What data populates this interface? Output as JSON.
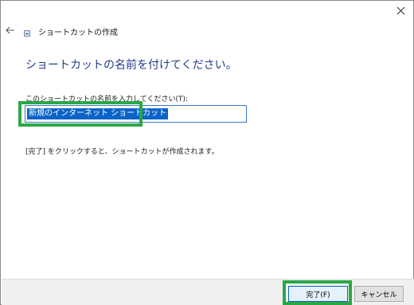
{
  "wizard": {
    "title": "ショートカットの作成",
    "heading": "ショートカットの名前を付けてください。",
    "name_label": "このショートカットの名前を入力してください(T):",
    "name_value": "新規のインターネット ショートカット",
    "finish_instruction": "[完了] をクリックすると、ショートカットが作成されます。"
  },
  "buttons": {
    "finish_label": "完了(F)",
    "cancel_label": "キャンセル"
  },
  "icons": {
    "close": "close-icon",
    "back": "back-arrow-icon",
    "wizard": "shortcut-wizard-icon"
  },
  "colors": {
    "heading": "#1f3c8a",
    "selection": "#0a64c8",
    "highlight_box": "#2aa845"
  }
}
